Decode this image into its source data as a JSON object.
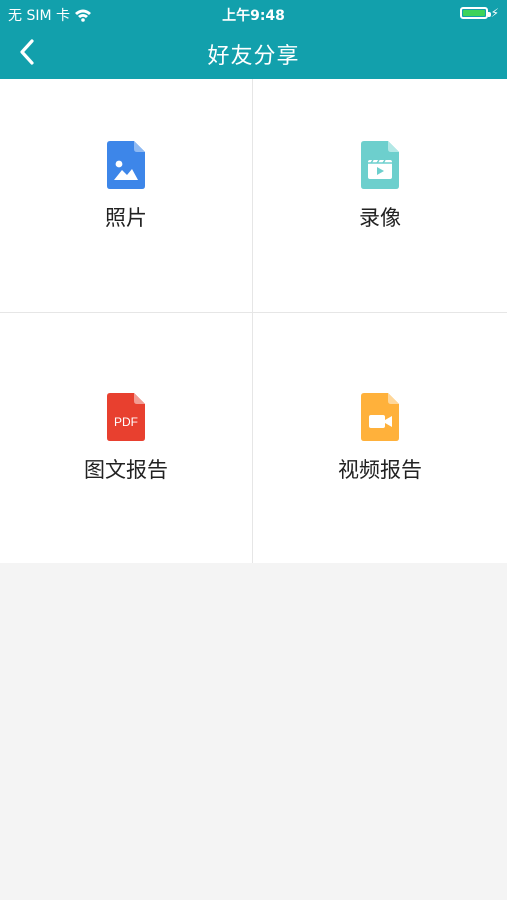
{
  "status_bar": {
    "carrier": "无 SIM 卡",
    "time": "上午9:48",
    "battery_level": 1.0
  },
  "header": {
    "title": "好友分享",
    "background": "#12a0ac",
    "back_icon": "chevron-left-icon"
  },
  "options": [
    {
      "label": "照片",
      "icon": "image-file-icon",
      "color": "#3d86e9"
    },
    {
      "label": "录像",
      "icon": "video-recording-file-icon",
      "color": "#6dcfcd"
    },
    {
      "label": "图文报告",
      "icon": "pdf-file-icon",
      "color": "#e8402f",
      "icon_text": "PDF"
    },
    {
      "label": "视频报告",
      "icon": "video-camera-file-icon",
      "color": "#ffb13b"
    }
  ]
}
